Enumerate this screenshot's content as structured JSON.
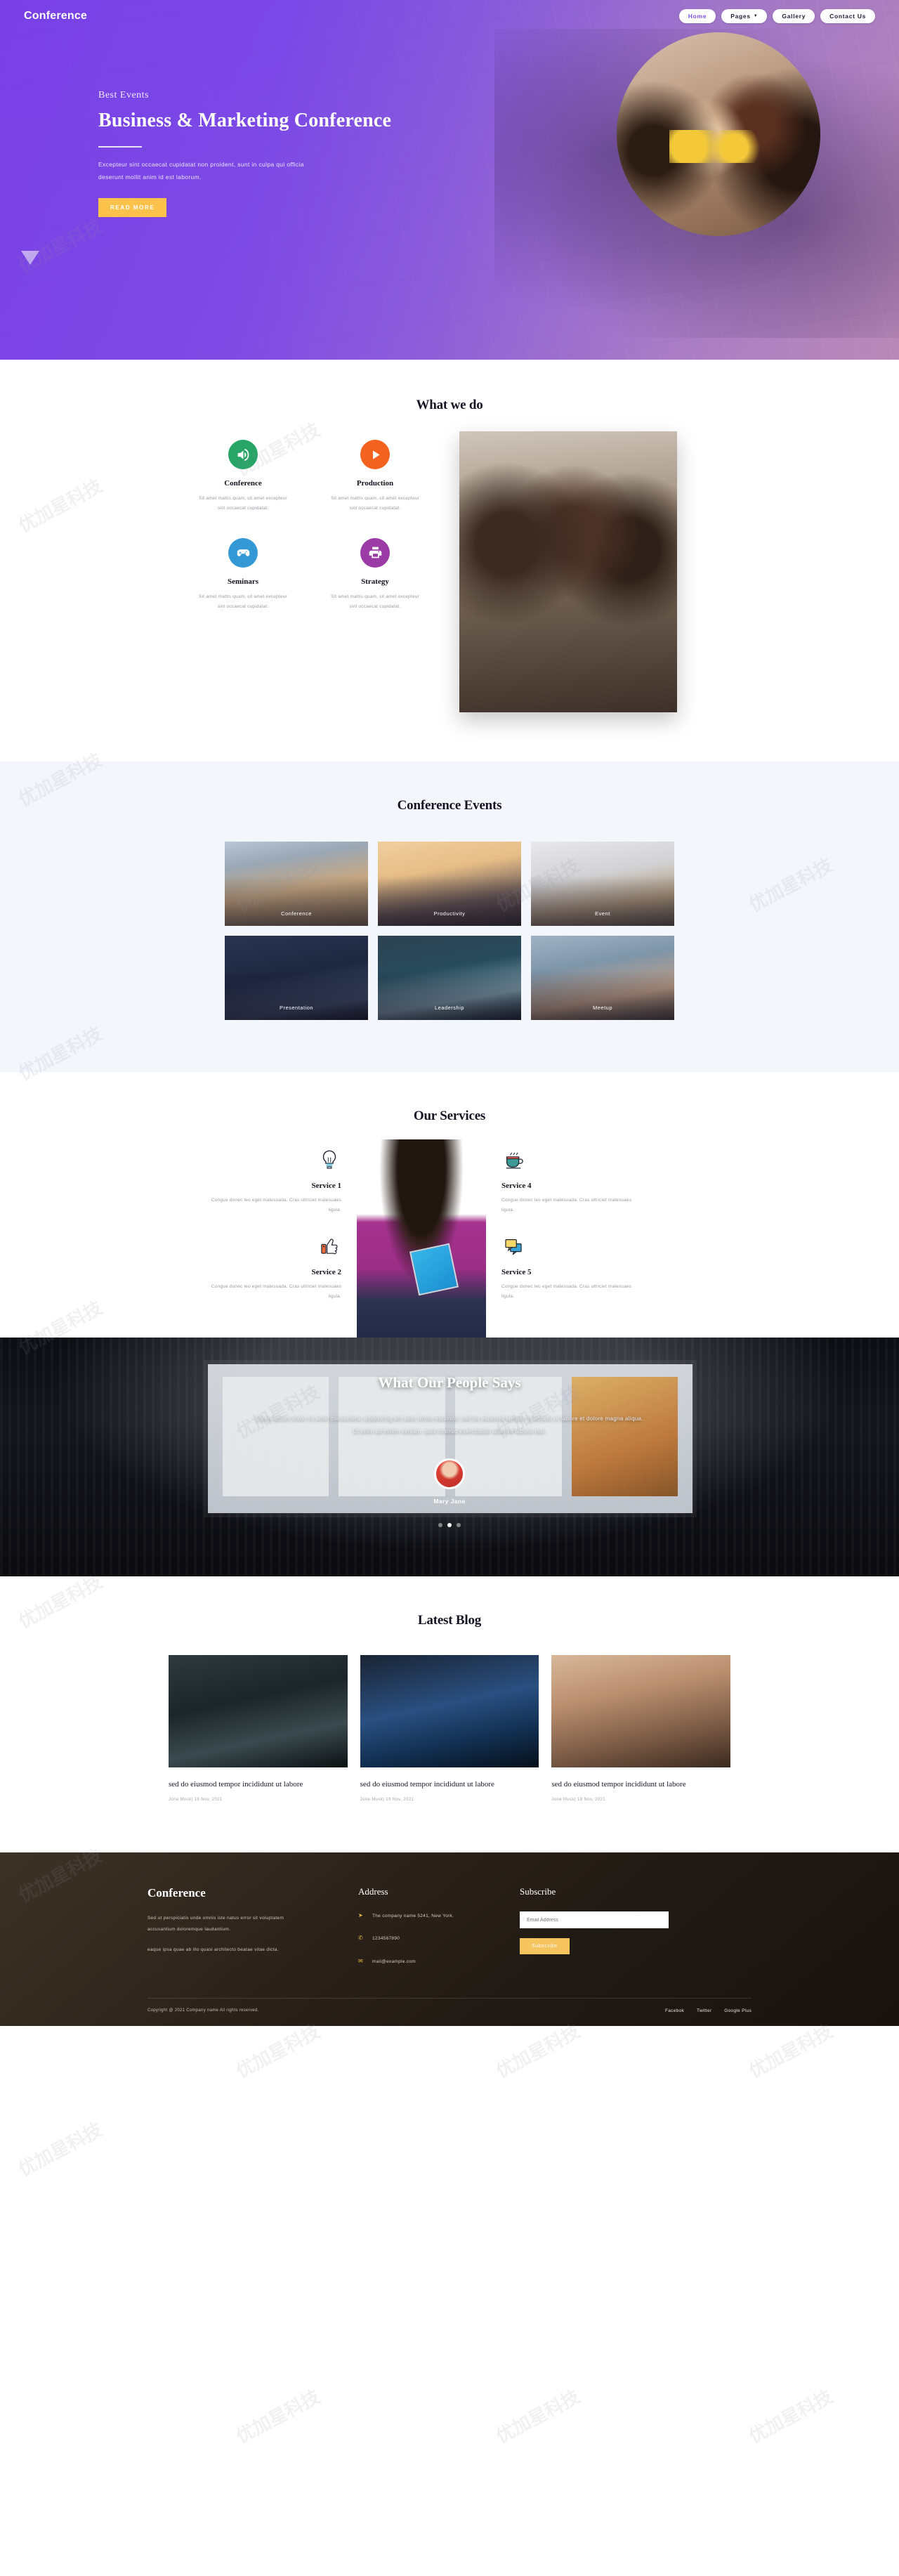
{
  "brand": "Conference",
  "nav": {
    "items": [
      {
        "label": "Home",
        "active": true,
        "caret": false
      },
      {
        "label": "Pages",
        "active": false,
        "caret": true
      },
      {
        "label": "Gallery",
        "active": false,
        "caret": false
      },
      {
        "label": "Contact Us",
        "active": false,
        "caret": false
      }
    ]
  },
  "hero": {
    "kicker": "Best Events",
    "title": "Business & Marketing Conference",
    "subtitle": "Excepteur sint occaecat cupidatat non proident, sunt in culpa qui officia deserunt mollit anim id est laborum.",
    "button": "READ MORE",
    "accent_purple": "#7a42e8",
    "accent_amber": "#fcc24c"
  },
  "what_we_do": {
    "title": "What we do",
    "cards": [
      {
        "name": "Conference",
        "desc": "Sit amet mattis quam, sit amet excepteur sint occaecat cupidatat.",
        "icon": "speaker-icon",
        "color": "#27a567"
      },
      {
        "name": "Production",
        "desc": "Sit amet mattis quam, sit amet excepteur sint occaecat cupidatat.",
        "icon": "play-icon",
        "color": "#f4621f"
      },
      {
        "name": "Seminars",
        "desc": "Sit amet mattis quam, sit amet excepteur sint occaecat cupidatat.",
        "icon": "gamepad-icon",
        "color": "#3398d4"
      },
      {
        "name": "Strategy",
        "desc": "Sit amet mattis quam, sit amet excepteur sint occaecat cupidatat.",
        "icon": "printer-icon",
        "color": "#9b3ba5"
      }
    ]
  },
  "events": {
    "title": "Conference Events",
    "items": [
      {
        "caption": "Conference"
      },
      {
        "caption": "Productivity"
      },
      {
        "caption": "Event"
      },
      {
        "caption": "Presentation"
      },
      {
        "caption": "Leadership"
      },
      {
        "caption": "Meetup"
      }
    ]
  },
  "services": {
    "title": "Our Services",
    "left": [
      {
        "name": "Service 1",
        "desc": "Congue donec leo eget malesuada. Cras ultriciet malesuaes ligula.",
        "icon": "lightbulb-icon"
      },
      {
        "name": "Service 2",
        "desc": "Congue donec leo eget malesuada. Cras ultriciet malesuaes ligula.",
        "icon": "thumbs-up-icon"
      }
    ],
    "right": [
      {
        "name": "Service 4",
        "desc": "Congue donec leo eget malesuada. Cras ultriciet malesuaes ligula.",
        "icon": "coffee-cup-icon"
      },
      {
        "name": "Service 5",
        "desc": "Congue donec leo eget malesuada. Cras ultriciet malesuaes ligula.",
        "icon": "chat-bubbles-icon"
      }
    ]
  },
  "testimonial": {
    "title": "What Our People Says",
    "quote": "Lorem ipsum dolor sit amet consectetur adipisicing elit sedc dnmo eiusmod. sed do eiusmod tempor incididunt ut labore et dolore magna aliqua. Ut enim ad minim veniam, quis nostrud exercitation ullamco laboris nisi.",
    "author": "Mary Jane",
    "dots": 3,
    "active_dot": 1
  },
  "blog": {
    "title": "Latest Blog",
    "posts": [
      {
        "title": "sed do eiusmod tempor incididunt ut labore",
        "meta": "Jone Musk| 19 Nov, 2021"
      },
      {
        "title": "sed do eiusmod tempor incididunt ut labore",
        "meta": "Jone Musk| 19 Nov, 2021"
      },
      {
        "title": "sed do eiusmod tempor incididunt ut labore",
        "meta": "Jone Musk| 19 Nov, 2021"
      }
    ]
  },
  "footer": {
    "brand": "Conference",
    "about_1": "Sed ut perspiciatis unde omnis iste natus error sit voluptatem accusantium doloremque laudantium.",
    "about_2": "eaque ipsa quae ab illo quasi architecto beatae vitae dicta.",
    "address_head": "Address",
    "address_line": "The company name 5241, New York.",
    "phone": "1234567890",
    "email": "mail@example.com",
    "subscribe_head": "Subscribe",
    "email_placeholder": "Email Address",
    "email_value": "",
    "subscribe_button": "Subscribe",
    "copyright": "Copyright @ 2021 Company name All rights reserved.",
    "socials": [
      "Facebok",
      "Twitter",
      "Google Plus"
    ]
  },
  "watermark": "优加星科技"
}
